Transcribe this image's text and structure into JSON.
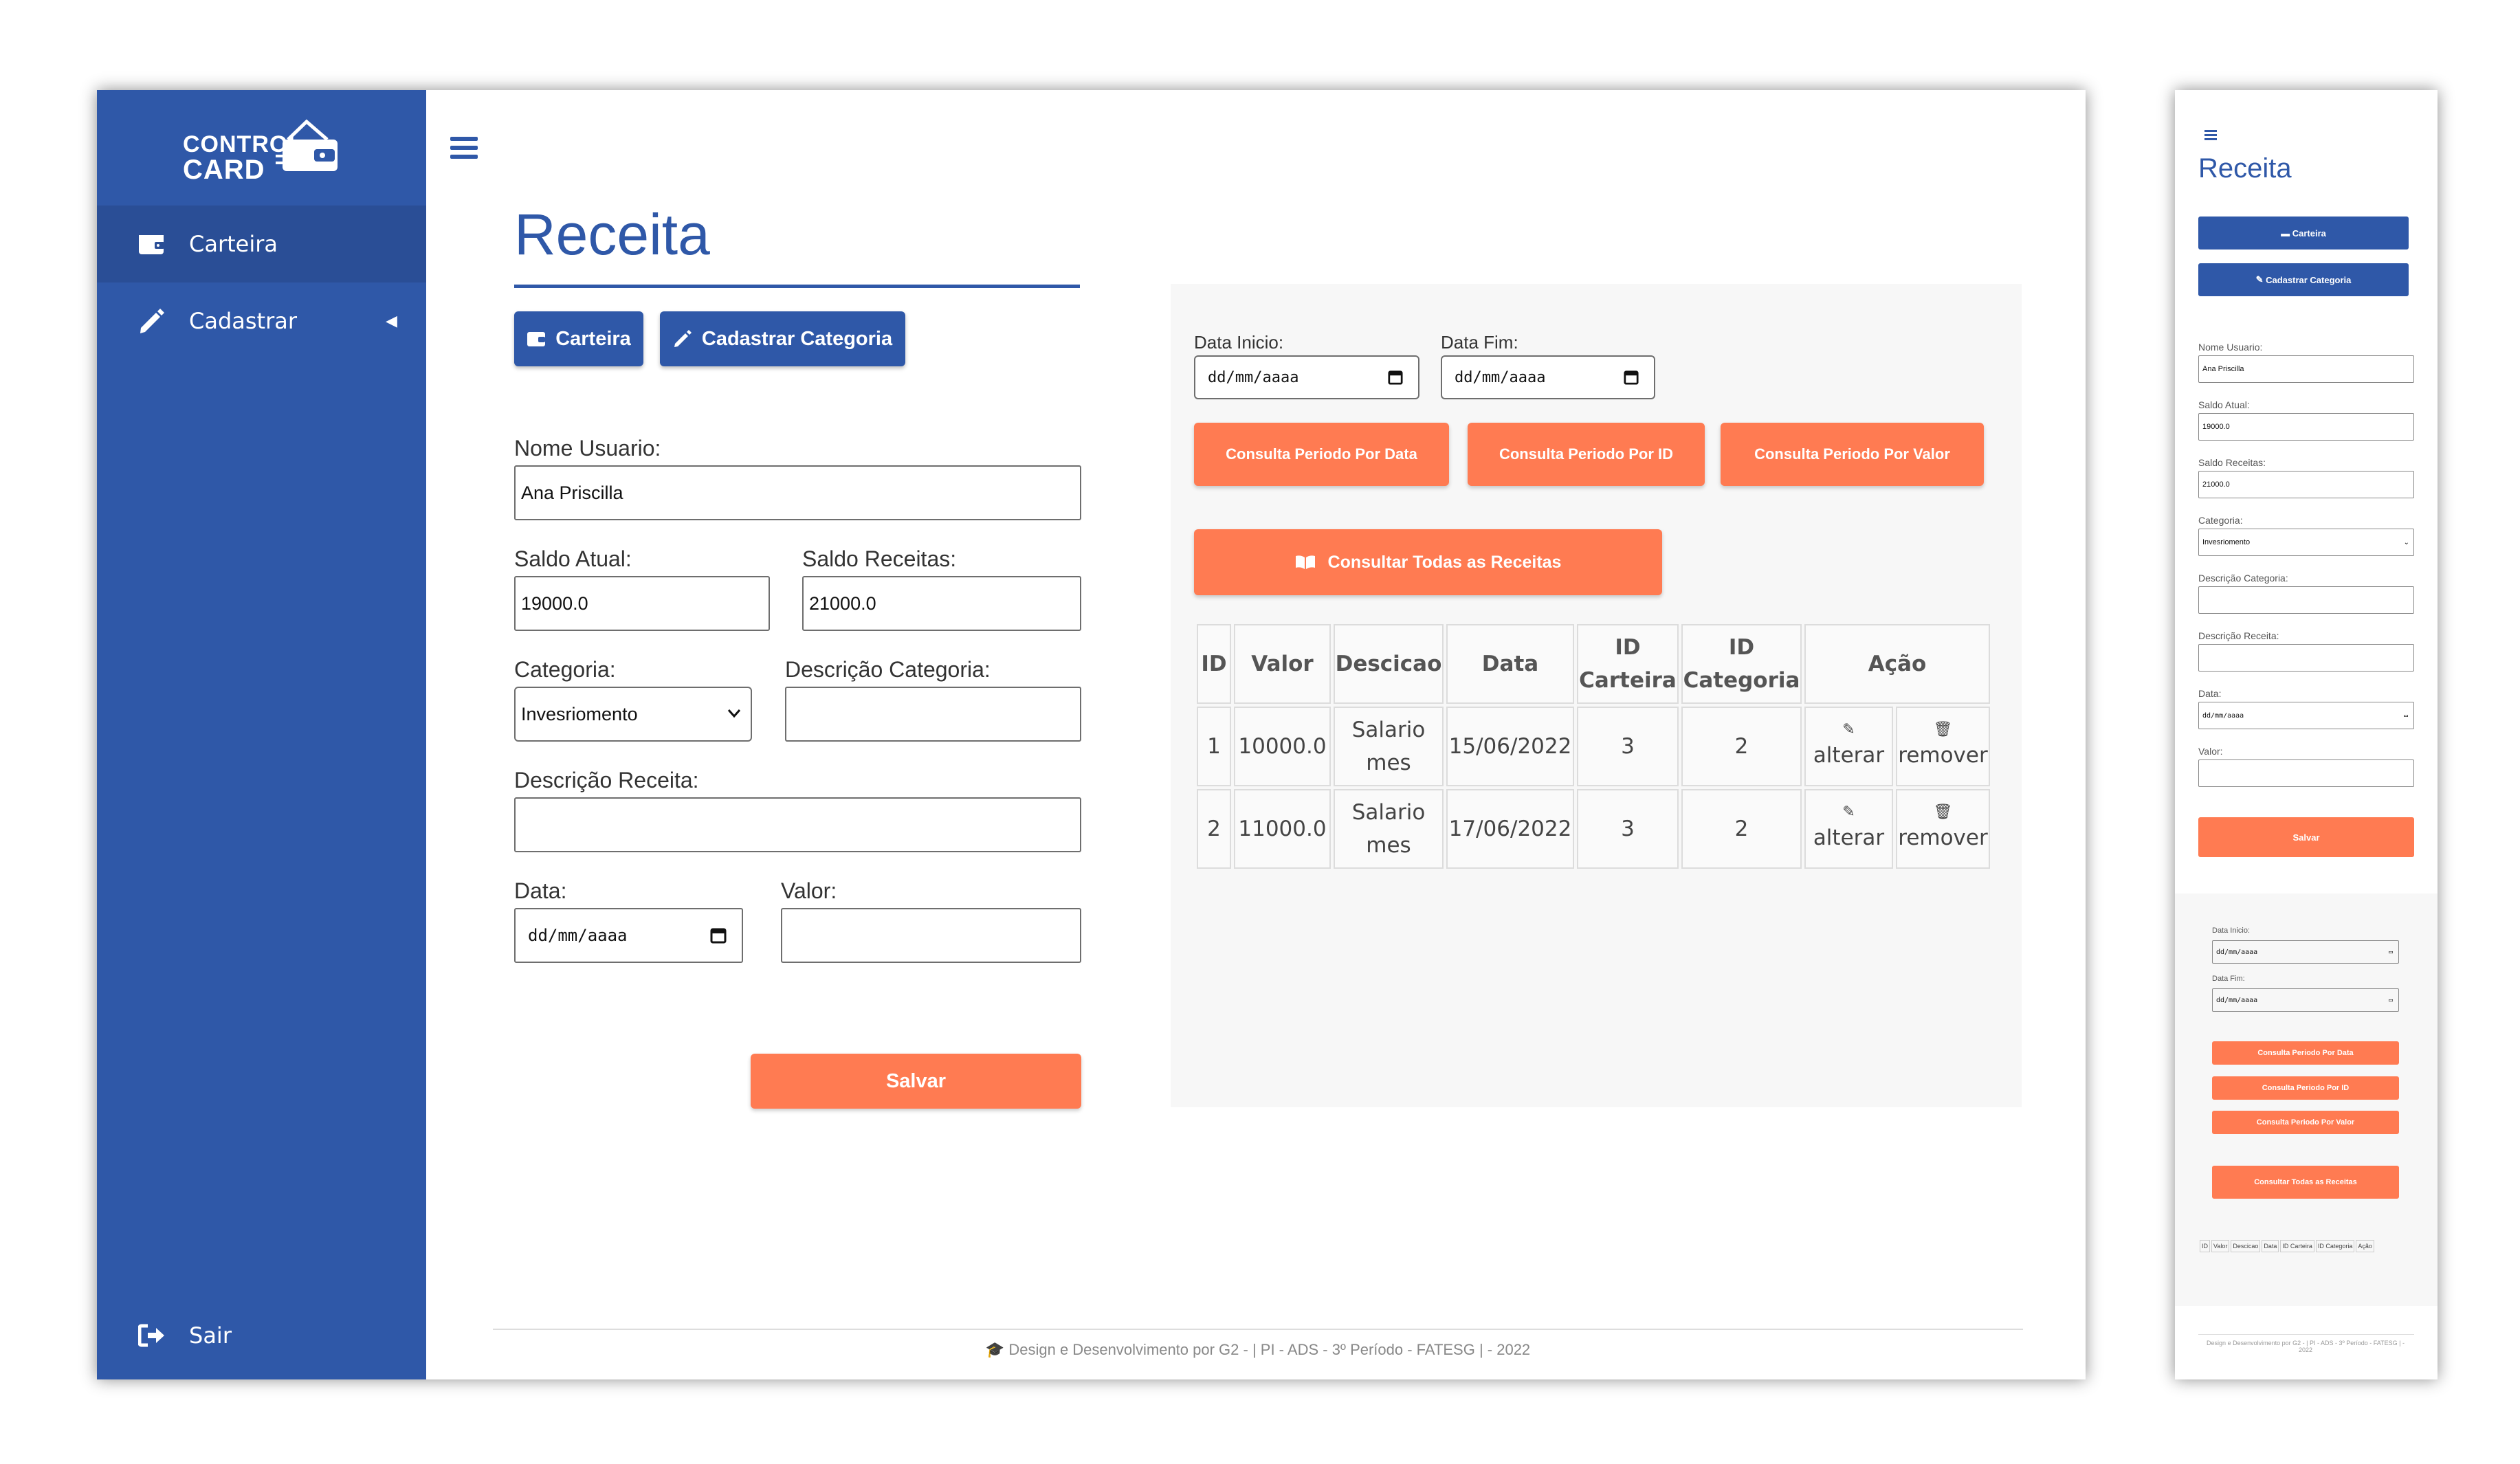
{
  "app": {
    "logo_line1": "CONTROL",
    "logo_line2": "CARD"
  },
  "colors": {
    "primary": "#2f58a8",
    "accent": "#ff7b52",
    "panel": "#f7f7f7"
  },
  "sidebar": {
    "items": [
      {
        "label": "Carteira",
        "icon": "wallet-icon"
      },
      {
        "label": "Cadastrar",
        "icon": "pencil-icon"
      }
    ],
    "logout": "Sair"
  },
  "page": {
    "title": "Receita",
    "buttons": {
      "carteira": "Carteira",
      "cadastrar_categoria": "Cadastrar Categoria"
    }
  },
  "form": {
    "nome_label": "Nome Usuario:",
    "nome_value": "Ana Priscilla",
    "saldo_atual_label": "Saldo Atual:",
    "saldo_atual_value": "19000.0",
    "saldo_receitas_label": "Saldo Receitas:",
    "saldo_receitas_value": "21000.0",
    "categoria_label": "Categoria:",
    "categoria_value": "Invesriomento",
    "desc_categoria_label": "Descrição Categoria:",
    "desc_categoria_value": "",
    "desc_receita_label": "Descrição Receita:",
    "desc_receita_value": "",
    "data_label": "Data:",
    "data_placeholder": "dd/mm/aaaa",
    "valor_label": "Valor:",
    "valor_value": "",
    "salvar": "Salvar"
  },
  "query": {
    "data_inicio_label": "Data Inicio:",
    "data_fim_label": "Data Fim:",
    "date_placeholder": "dd/mm/aaaa",
    "btn_data": "Consulta Periodo Por Data",
    "btn_id": "Consulta Periodo Por ID",
    "btn_valor": "Consulta Periodo Por Valor",
    "btn_todas": "Consultar Todas as Receitas"
  },
  "table": {
    "headers": [
      "ID",
      "Valor",
      "Descicao",
      "Data",
      "ID Carteira",
      "ID Categoria",
      "Ação"
    ],
    "rows": [
      {
        "id": "1",
        "valor": "10000.0",
        "desc": "Salario mes",
        "data": "15/06/2022",
        "carteira": "3",
        "categoria": "2",
        "alterar": "alterar",
        "remover": "remover"
      },
      {
        "id": "2",
        "valor": "11000.0",
        "desc": "Salario mes",
        "data": "17/06/2022",
        "carteira": "3",
        "categoria": "2",
        "alterar": "alterar",
        "remover": "remover"
      }
    ]
  },
  "footer": "Design e Desenvolvimento por G2 - | PI - ADS - 3º Período - FATESG | - 2022",
  "mobile": {
    "title": "Receita",
    "btn_carteira": "Carteira",
    "btn_cadastrar": "Cadastrar Categoria",
    "nome_label": "Nome Usuario:",
    "nome_value": "Ana Priscilla",
    "saldo_atual_label": "Saldo Atual:",
    "saldo_atual_value": "19000.0",
    "saldo_receitas_label": "Saldo Receitas:",
    "saldo_receitas_value": "21000.0",
    "categoria_label": "Categoria:",
    "categoria_value": "Invesriomento",
    "desc_categoria_label": "Descrição Categoria:",
    "desc_receita_label": "Descrição Receita:",
    "data_label": "Data:",
    "date_placeholder": "dd/mm/aaaa",
    "valor_label": "Valor:",
    "salvar": "Salvar",
    "data_inicio_label": "Data Inicio:",
    "data_fim_label": "Data Fim:",
    "btn_data": "Consulta Periodo Por Data",
    "btn_id": "Consulta Periodo Por ID",
    "btn_valor": "Consulta Periodo Por Valor",
    "btn_todas": "Consultar Todas as Receitas",
    "headers": [
      "ID",
      "Valor",
      "Descicao",
      "Data",
      "ID Carteira",
      "ID Categoria",
      "Ação"
    ],
    "footer": "Design e Desenvolvimento por G2 - | PI - ADS - 3º Período - FATESG | - 2022"
  }
}
